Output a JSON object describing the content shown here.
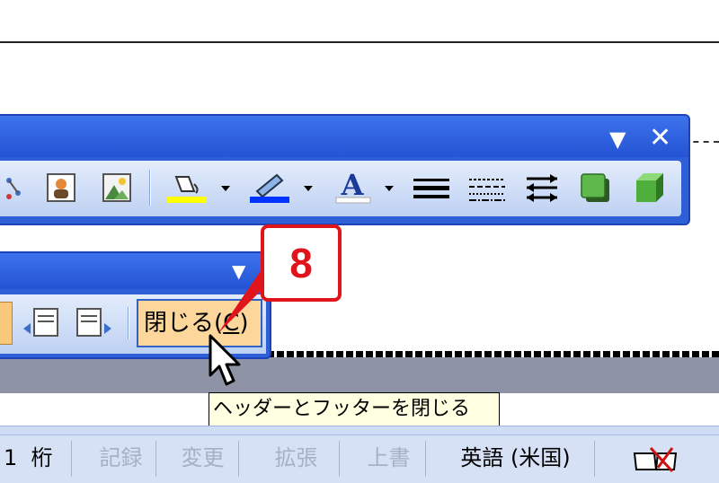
{
  "drawing_toolbar": {
    "buttons": [
      {
        "name": "diagram-icon"
      },
      {
        "name": "clipart-icon"
      },
      {
        "name": "picture-icon"
      },
      {
        "name": "fill-color-icon",
        "swatch": "#ffff00"
      },
      {
        "name": "line-color-icon",
        "swatch": "#0033ff"
      },
      {
        "name": "font-color-icon",
        "swatch": "#ffffff"
      },
      {
        "name": "line-style-icon"
      },
      {
        "name": "dash-style-icon"
      },
      {
        "name": "arrow-style-icon"
      },
      {
        "name": "shadow-style-icon"
      },
      {
        "name": "3d-style-icon"
      }
    ],
    "font_color_glyph": "A"
  },
  "header_footer_toolbar": {
    "close_label": "閉じる",
    "close_accel": "C"
  },
  "callout": {
    "number": "8",
    "color": "#e0141b"
  },
  "tooltip": {
    "text": "ヘッダーとフッターを閉じる"
  },
  "statusbar": {
    "column_prefix": "1",
    "column_label": "桁",
    "record": "記録",
    "change": "変更",
    "extend": "拡張",
    "overwrite": "上書",
    "language": "英語 (米国)"
  },
  "colors": {
    "toolbar_title": "#2453d3",
    "toolbar_body": "#d2dff8",
    "button_highlight": "#fcd69a"
  }
}
